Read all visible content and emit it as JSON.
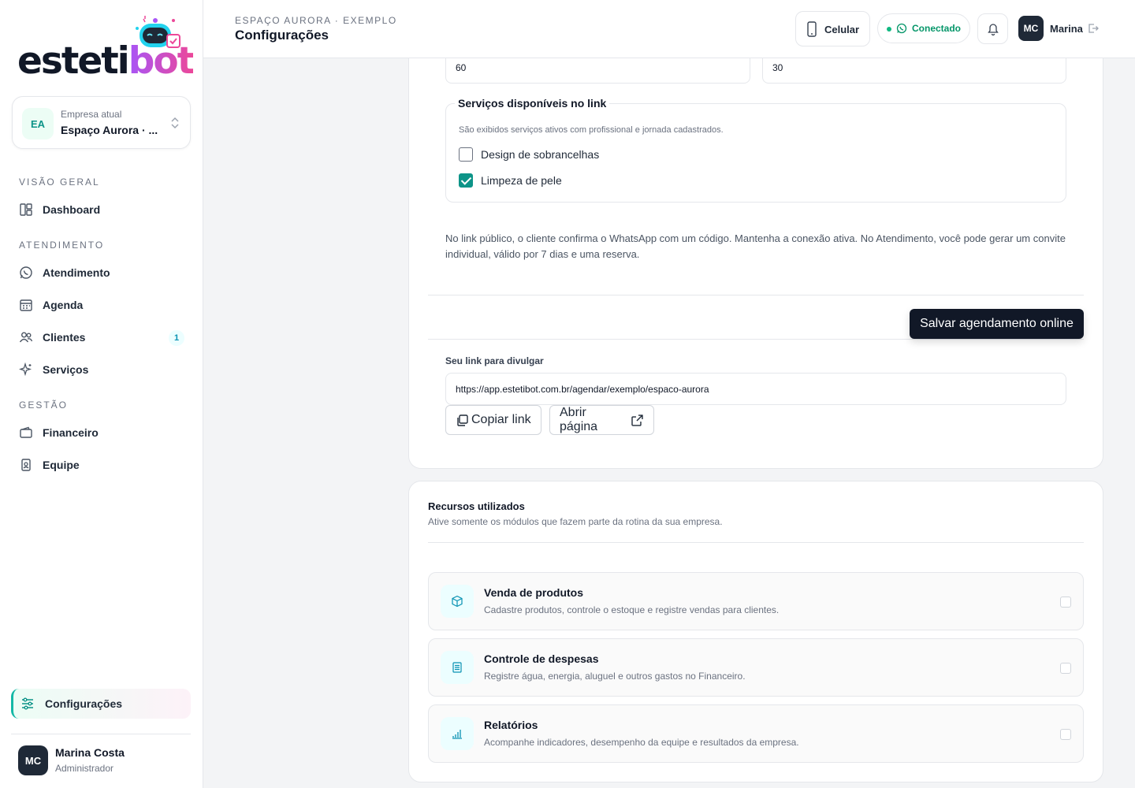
{
  "sidebar": {
    "brand": {
      "part1": "esteti",
      "part2": "bot"
    },
    "company": {
      "initials": "EA",
      "label": "Empresa atual",
      "name": "Espaço Aurora · ..."
    },
    "sections": {
      "overview": "VISÃO GERAL",
      "service": "ATENDIMENTO",
      "management": "GESTÃO"
    },
    "items": {
      "dashboard": "Dashboard",
      "atendimento": "Atendimento",
      "agenda": "Agenda",
      "clientes": "Clientes",
      "clientes_badge": "1",
      "servicos": "Serviços",
      "financeiro": "Financeiro",
      "equipe": "Equipe",
      "configuracoes": "Configurações"
    },
    "user": {
      "initials": "MC",
      "name": "Marina Costa",
      "role": "Administrador"
    }
  },
  "header": {
    "breadcrumb": "ESPAÇO AURORA · EXEMPLO",
    "title": "Configurações",
    "phone_label": "Celular",
    "status_label": "Conectado",
    "user_initials": "MC",
    "user_name": "Marina"
  },
  "booking": {
    "field_left_value": "60",
    "field_right_value": "30",
    "services_legend": "Serviços disponíveis no link",
    "services_hint": "São exibidos serviços ativos com profissional e jornada cadastrados.",
    "services": [
      {
        "label": "Design de sobrancelhas",
        "checked": false
      },
      {
        "label": "Limpeza de pele",
        "checked": true
      }
    ],
    "note": "No link público, o cliente confirma o WhatsApp com um código. Mantenha a conexão ativa. No Atendimento, você pode gerar um convite individual, válido por 7 dias e uma reserva.",
    "save_label": "Salvar agendamento online",
    "link_label": "Seu link para divulgar",
    "link_value": "https://app.estetibot.com.br/agendar/exemplo/espaco-aurora",
    "copy_label": "Copiar link",
    "open_label": "Abrir página"
  },
  "resources": {
    "title": "Recursos utilizados",
    "subtitle": "Ative somente os módulos que fazem parte da rotina da sua empresa.",
    "items": [
      {
        "title": "Venda de produtos",
        "desc": "Cadastre produtos, controle o estoque e registre vendas para clientes.",
        "icon": "box-icon",
        "enabled": false
      },
      {
        "title": "Controle de despesas",
        "desc": "Registre água, energia, aluguel e outros gastos no Financeiro.",
        "icon": "receipt-icon",
        "enabled": false
      },
      {
        "title": "Relatórios",
        "desc": "Acompanhe indicadores, desempenho da equipe e resultados da empresa.",
        "icon": "bar-chart-icon",
        "enabled": false
      }
    ]
  },
  "colors": {
    "accent": "#0d9488",
    "brand_pink": "#ec4899",
    "brand_purple": "#a855f7",
    "dark": "#111827"
  }
}
